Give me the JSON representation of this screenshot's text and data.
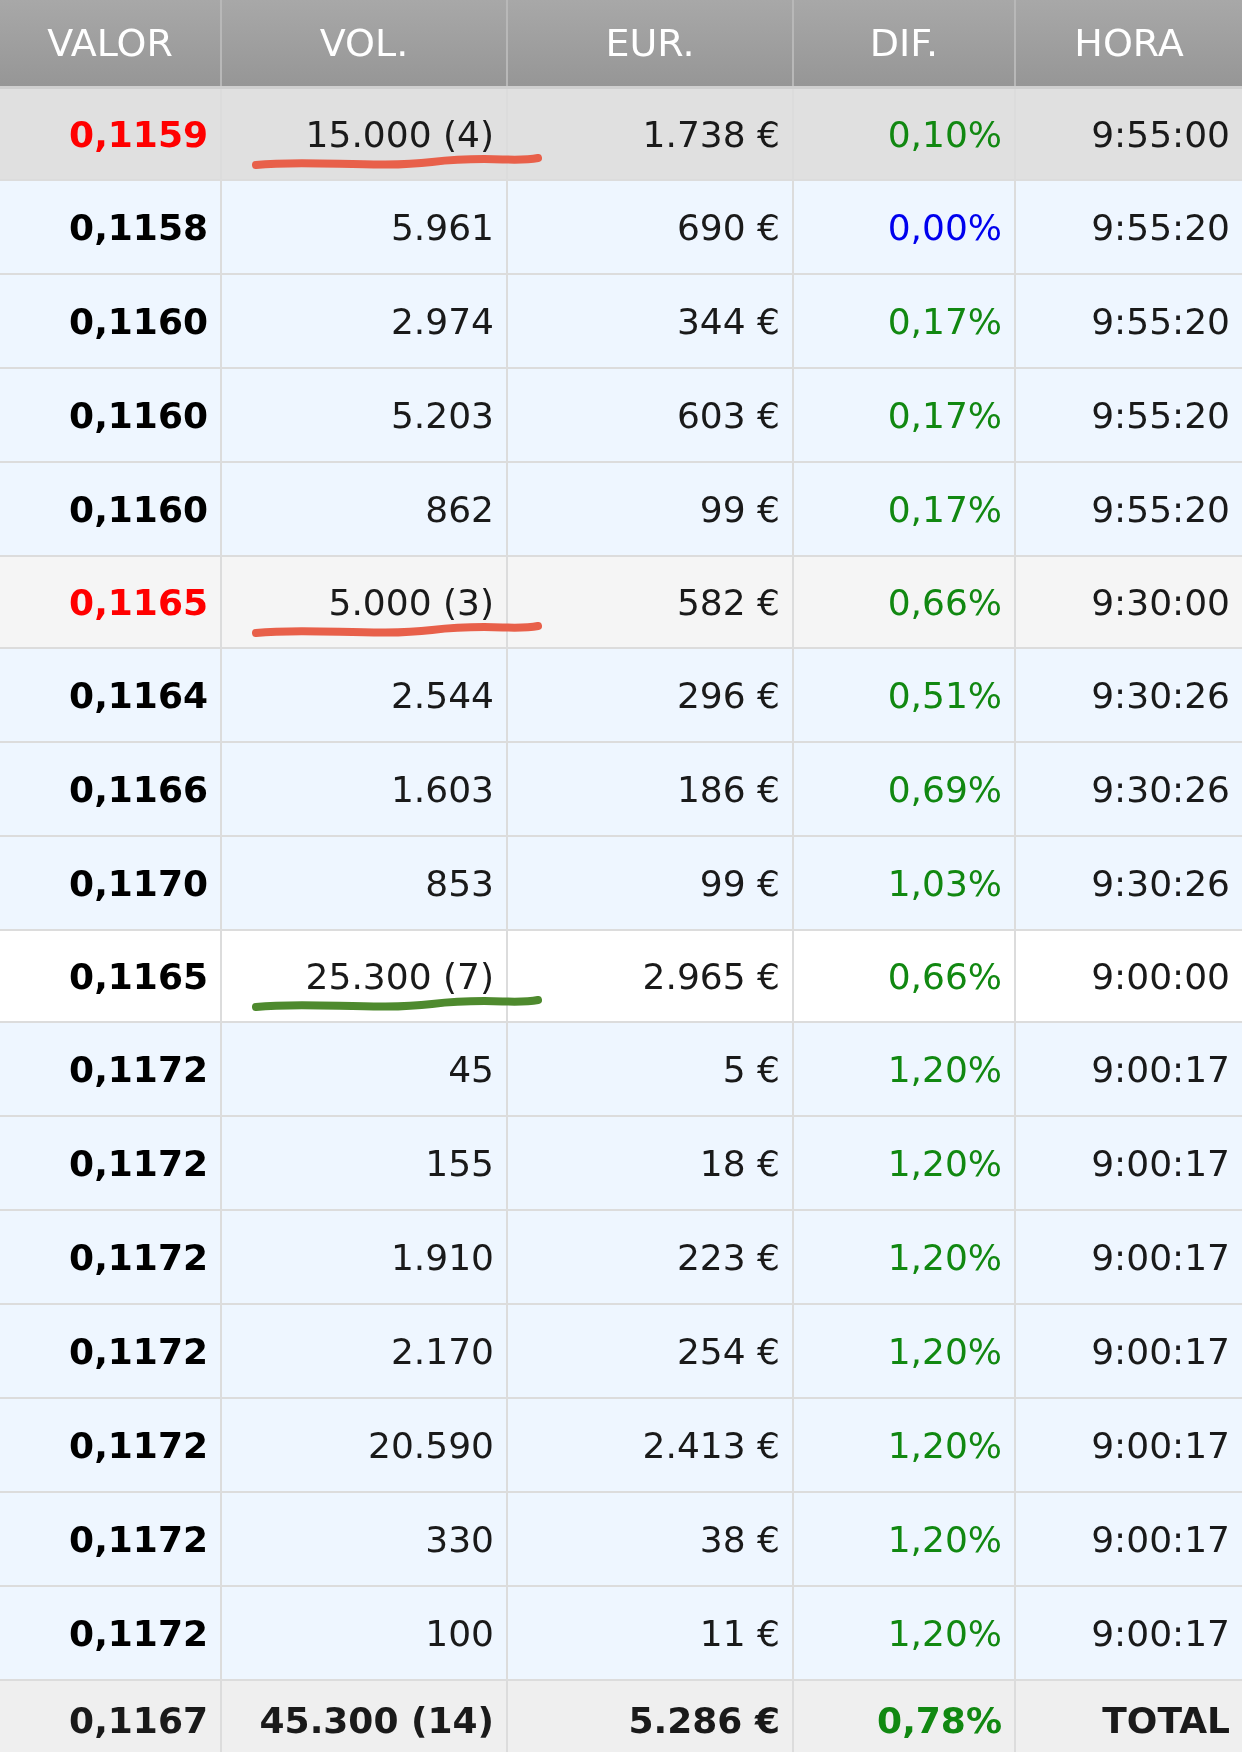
{
  "table": {
    "columns": [
      "VALOR",
      "VOL.",
      "EUR.",
      "DIF.",
      "HORA"
    ],
    "rows": [
      {
        "kind": "auction",
        "color": "#e0e0e0",
        "valor": {
          "text": "0,1159",
          "color": "#ff0000"
        },
        "vol": "15.000 (4)",
        "underline": {
          "color": "#e8604a"
        },
        "eur": "1.738 €",
        "dif": {
          "text": "0,10%",
          "color": "#118811"
        },
        "hora": "9:55:00"
      },
      {
        "kind": "trade",
        "color": "#eef6ff",
        "valor": {
          "text": "0,1158",
          "color": "#000000"
        },
        "vol": "5.961",
        "eur": "690 €",
        "dif": {
          "text": "0,00%",
          "color": "#0000ee"
        },
        "hora": "9:55:20"
      },
      {
        "kind": "trade",
        "color": "#eef6ff",
        "valor": {
          "text": "0,1160",
          "color": "#000000"
        },
        "vol": "2.974",
        "eur": "344 €",
        "dif": {
          "text": "0,17%",
          "color": "#118811"
        },
        "hora": "9:55:20"
      },
      {
        "kind": "trade",
        "color": "#eef6ff",
        "valor": {
          "text": "0,1160",
          "color": "#000000"
        },
        "vol": "5.203",
        "eur": "603 €",
        "dif": {
          "text": "0,17%",
          "color": "#118811"
        },
        "hora": "9:55:20"
      },
      {
        "kind": "trade",
        "color": "#eef6ff",
        "valor": {
          "text": "0,1160",
          "color": "#000000"
        },
        "vol": "862",
        "eur": "99 €",
        "dif": {
          "text": "0,17%",
          "color": "#118811"
        },
        "hora": "9:55:20"
      },
      {
        "kind": "auction",
        "color": "#f5f5f5",
        "valor": {
          "text": "0,1165",
          "color": "#ff0000"
        },
        "vol": "5.000 (3)",
        "underline": {
          "color": "#e8604a"
        },
        "eur": "582 €",
        "dif": {
          "text": "0,66%",
          "color": "#118811"
        },
        "hora": "9:30:00"
      },
      {
        "kind": "trade",
        "color": "#eef6ff",
        "valor": {
          "text": "0,1164",
          "color": "#000000"
        },
        "vol": "2.544",
        "eur": "296 €",
        "dif": {
          "text": "0,51%",
          "color": "#118811"
        },
        "hora": "9:30:26"
      },
      {
        "kind": "trade",
        "color": "#eef6ff",
        "valor": {
          "text": "0,1166",
          "color": "#000000"
        },
        "vol": "1.603",
        "eur": "186 €",
        "dif": {
          "text": "0,69%",
          "color": "#118811"
        },
        "hora": "9:30:26"
      },
      {
        "kind": "trade",
        "color": "#eef6ff",
        "valor": {
          "text": "0,1170",
          "color": "#000000"
        },
        "vol": "853",
        "eur": "99 €",
        "dif": {
          "text": "1,03%",
          "color": "#118811"
        },
        "hora": "9:30:26"
      },
      {
        "kind": "auction",
        "color": "#ffffff",
        "valor": {
          "text": "0,1165",
          "color": "#000000"
        },
        "vol": "25.300 (7)",
        "underline": {
          "color": "#4e8a2e"
        },
        "eur": "2.965 €",
        "dif": {
          "text": "0,66%",
          "color": "#118811"
        },
        "hora": "9:00:00"
      },
      {
        "kind": "trade",
        "color": "#eef6ff",
        "valor": {
          "text": "0,1172",
          "color": "#000000"
        },
        "vol": "45",
        "eur": "5 €",
        "dif": {
          "text": "1,20%",
          "color": "#118811"
        },
        "hora": "9:00:17"
      },
      {
        "kind": "trade",
        "color": "#eef6ff",
        "valor": {
          "text": "0,1172",
          "color": "#000000"
        },
        "vol": "155",
        "eur": "18 €",
        "dif": {
          "text": "1,20%",
          "color": "#118811"
        },
        "hora": "9:00:17"
      },
      {
        "kind": "trade",
        "color": "#eef6ff",
        "valor": {
          "text": "0,1172",
          "color": "#000000"
        },
        "vol": "1.910",
        "eur": "223 €",
        "dif": {
          "text": "1,20%",
          "color": "#118811"
        },
        "hora": "9:00:17"
      },
      {
        "kind": "trade",
        "color": "#eef6ff",
        "valor": {
          "text": "0,1172",
          "color": "#000000"
        },
        "vol": "2.170",
        "eur": "254 €",
        "dif": {
          "text": "1,20%",
          "color": "#118811"
        },
        "hora": "9:00:17"
      },
      {
        "kind": "trade",
        "color": "#eef6ff",
        "valor": {
          "text": "0,1172",
          "color": "#000000"
        },
        "vol": "20.590",
        "eur": "2.413 €",
        "dif": {
          "text": "1,20%",
          "color": "#118811"
        },
        "hora": "9:00:17"
      },
      {
        "kind": "trade",
        "color": "#eef6ff",
        "valor": {
          "text": "0,1172",
          "color": "#000000"
        },
        "vol": "330",
        "eur": "38 €",
        "dif": {
          "text": "1,20%",
          "color": "#118811"
        },
        "hora": "9:00:17"
      },
      {
        "kind": "trade",
        "color": "#eef6ff",
        "valor": {
          "text": "0,1172",
          "color": "#000000"
        },
        "vol": "100",
        "eur": "11 €",
        "dif": {
          "text": "1,20%",
          "color": "#118811"
        },
        "hora": "9:00:17"
      }
    ],
    "total": {
      "valor": "0,1167",
      "vol": "45.300 (14)",
      "eur": "5.286 €",
      "dif": {
        "text": "0,78%",
        "color": "#118811"
      },
      "label": "TOTAL"
    }
  }
}
